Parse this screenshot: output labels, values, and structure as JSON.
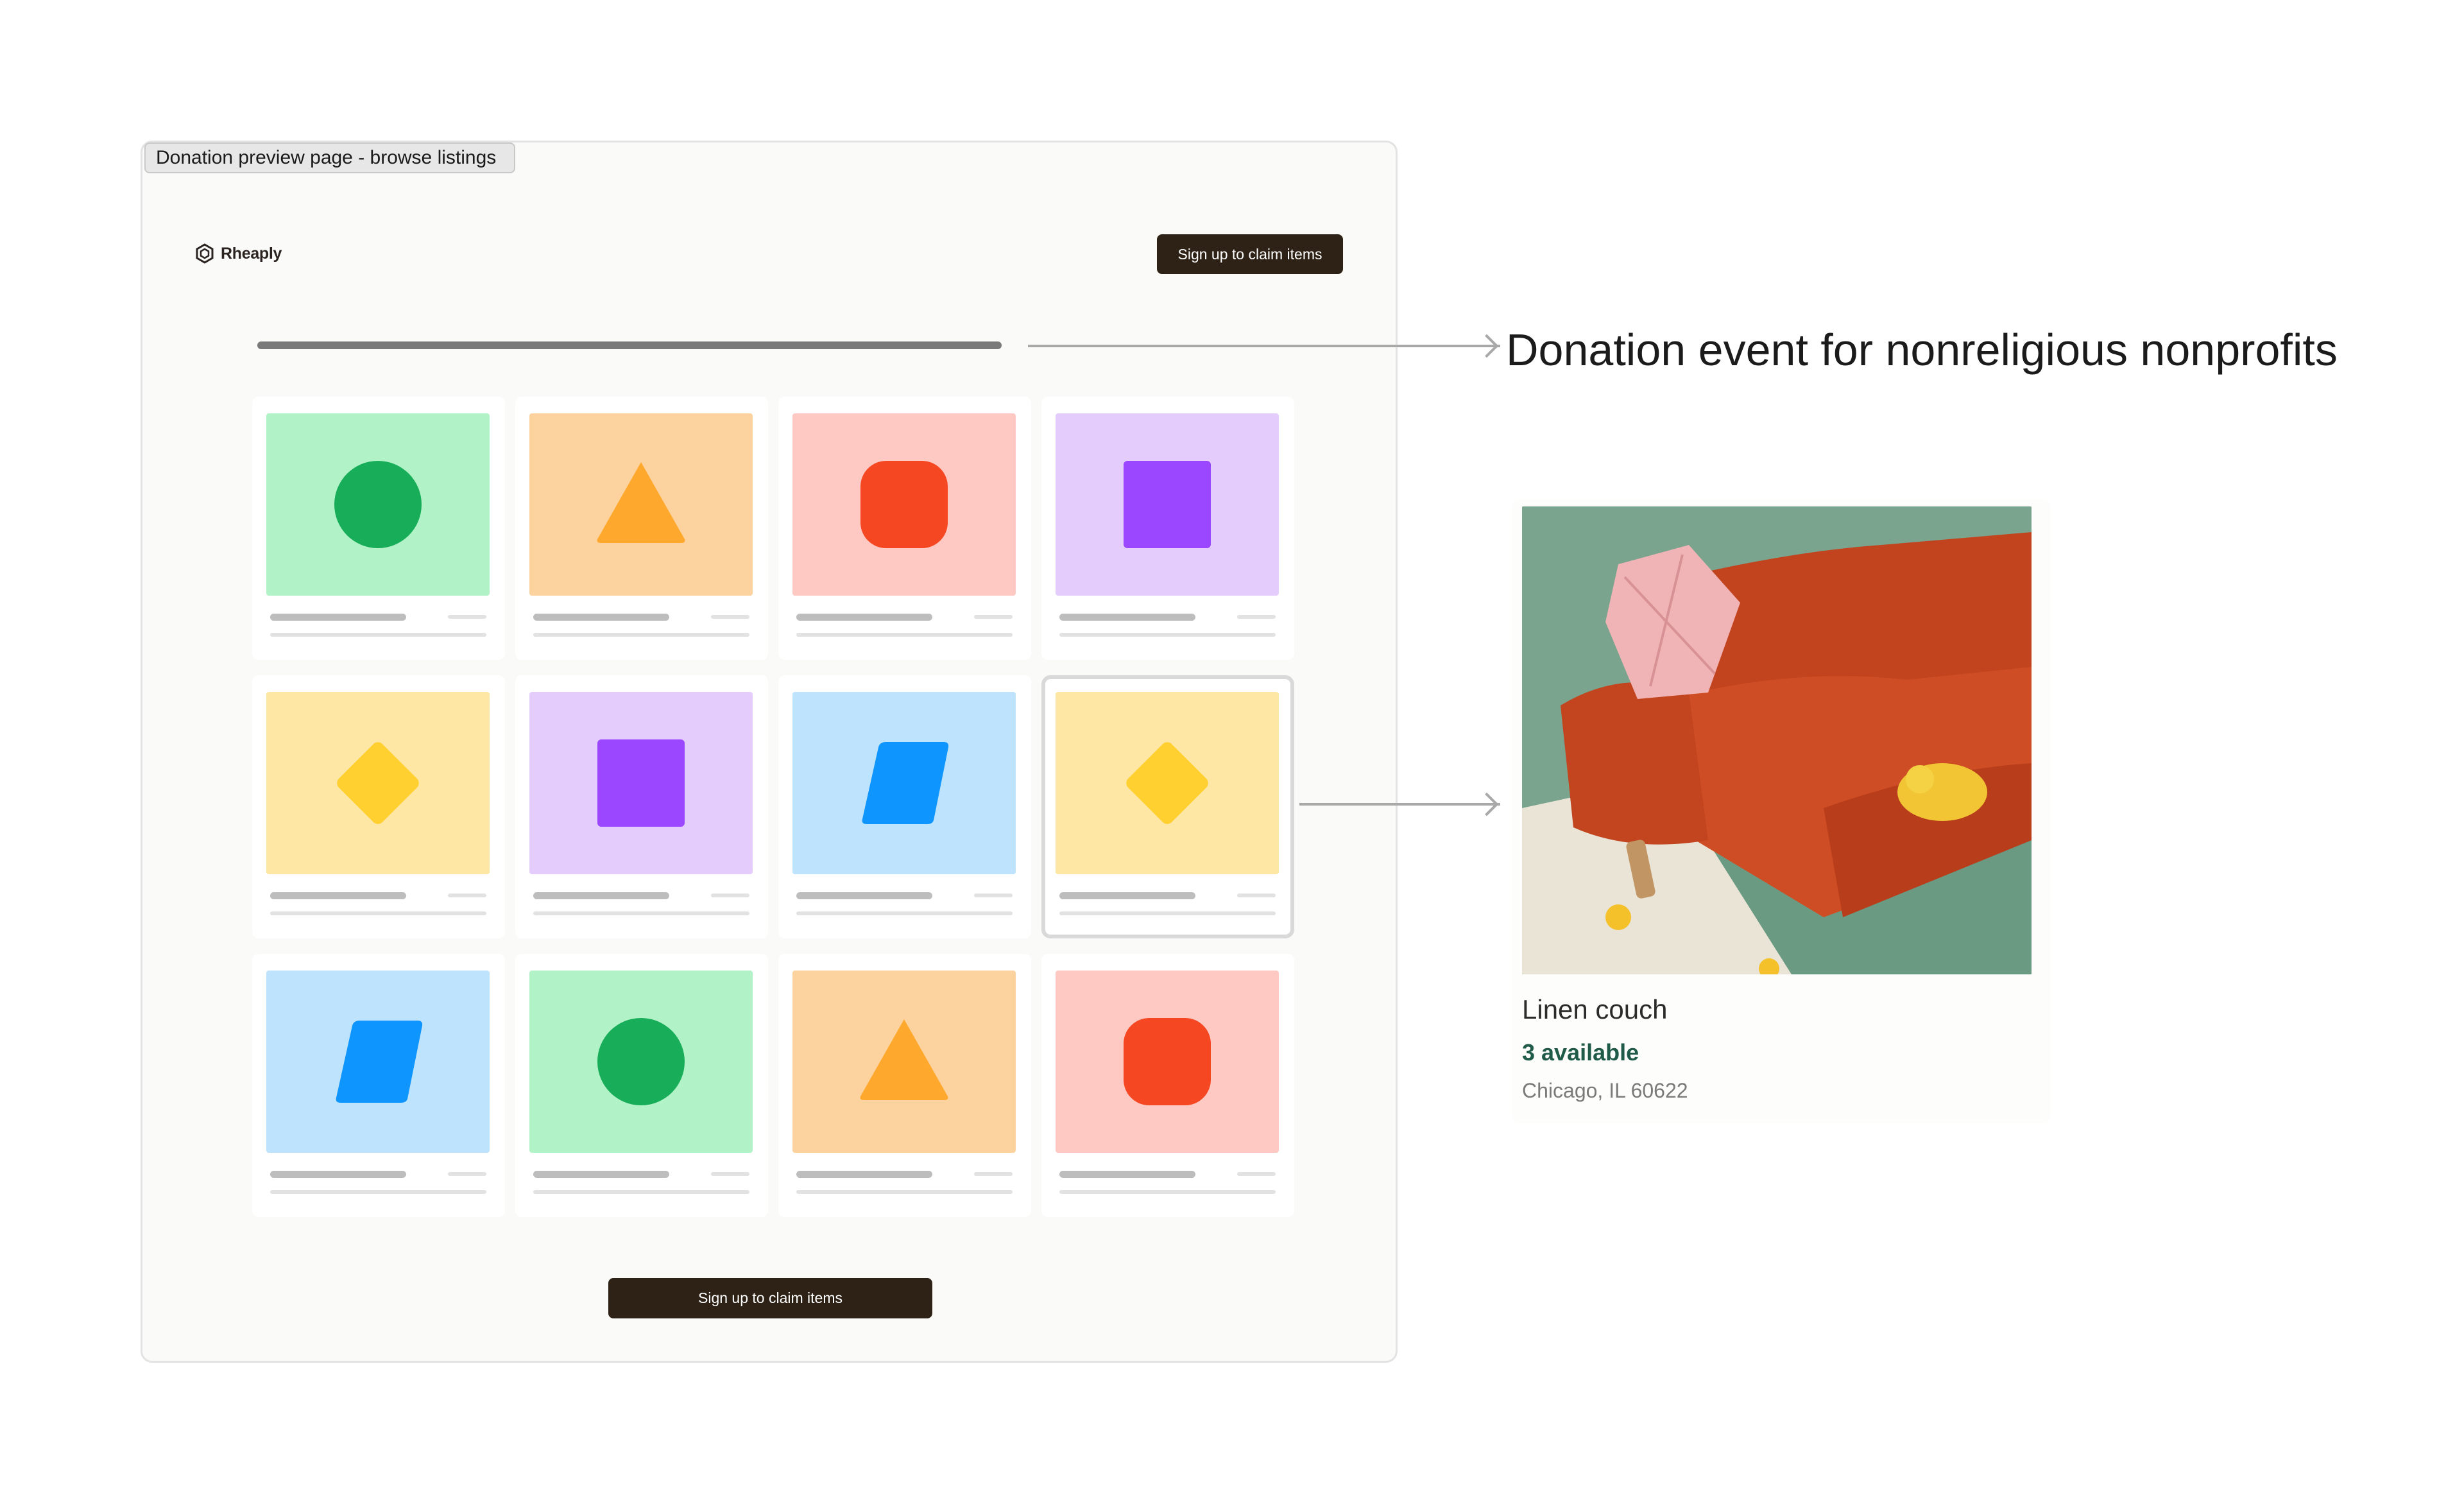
{
  "frame": {
    "label": "Donation preview page - browse listings"
  },
  "header": {
    "logo_text": "Rheaply",
    "logo_icon": "hexagon-logo-icon",
    "signup_label": "Sign up to claim items"
  },
  "footer": {
    "signup_label": "Sign up to claim items"
  },
  "annotation": {
    "event_title": "Donation event for nonreligious nonprofits"
  },
  "listings": [
    {
      "bg": "#b1f2c6",
      "shape": "circle",
      "color": "#17ad59"
    },
    {
      "bg": "#fcd29e",
      "shape": "triangle",
      "color": "#ffa82e"
    },
    {
      "bg": "#fec8c3",
      "shape": "rounded-square",
      "color": "#f64723"
    },
    {
      "bg": "#e4cdfd",
      "shape": "square",
      "color": "#9a47ff"
    },
    {
      "bg": "#fee6a4",
      "shape": "diamond",
      "color": "#ffd02f"
    },
    {
      "bg": "#e4cdfd",
      "shape": "square",
      "color": "#9a47ff"
    },
    {
      "bg": "#bee3fd",
      "shape": "parallelogram",
      "color": "#0f95fe"
    },
    {
      "bg": "#fee6a4",
      "shape": "diamond",
      "color": "#ffd02f",
      "selected": true
    },
    {
      "bg": "#bee3fd",
      "shape": "parallelogram",
      "color": "#0f95fe"
    },
    {
      "bg": "#b1f2c6",
      "shape": "circle",
      "color": "#17ad59"
    },
    {
      "bg": "#fcd29e",
      "shape": "triangle",
      "color": "#ffa82e"
    },
    {
      "bg": "#fec8c3",
      "shape": "rounded-square",
      "color": "#f64723"
    }
  ],
  "detail": {
    "name": "Linen couch",
    "availability": "3 available",
    "location": "Chicago, IL 60622"
  }
}
